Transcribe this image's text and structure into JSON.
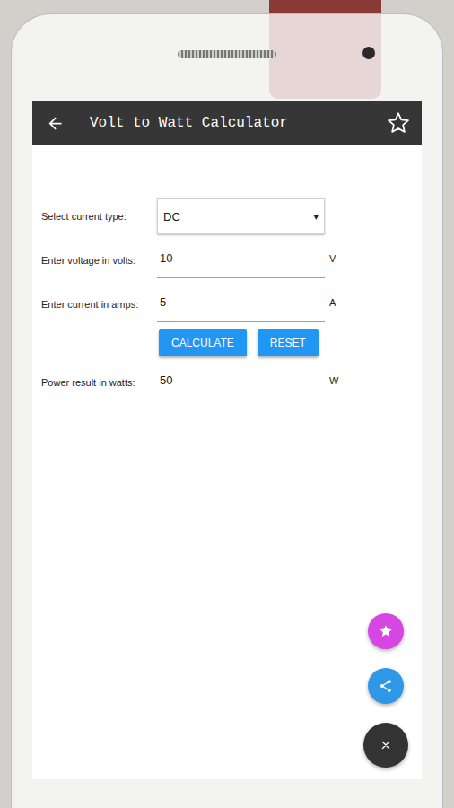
{
  "toolbar": {
    "title": "Volt to Watt Calculator",
    "favorite": false
  },
  "fields": [
    {
      "kind": "select",
      "label": "Select current type:",
      "value": "DC",
      "arrow": "▾",
      "unit": ""
    },
    {
      "kind": "input",
      "label": "Enter voltage in volts:",
      "value": "10",
      "arrow": "",
      "unit": "V"
    },
    {
      "kind": "input",
      "label": "Enter current in amps:",
      "value": "5",
      "arrow": "",
      "unit": "A"
    }
  ],
  "buttons": [
    "CALCULATE",
    "RESET"
  ],
  "result": {
    "label": "Power result in watts:",
    "value": "50",
    "unit": "W"
  },
  "fabs": [
    {
      "color": "#d646e3"
    },
    {
      "color": "#2e97e6"
    },
    {
      "color": "#333333"
    }
  ]
}
